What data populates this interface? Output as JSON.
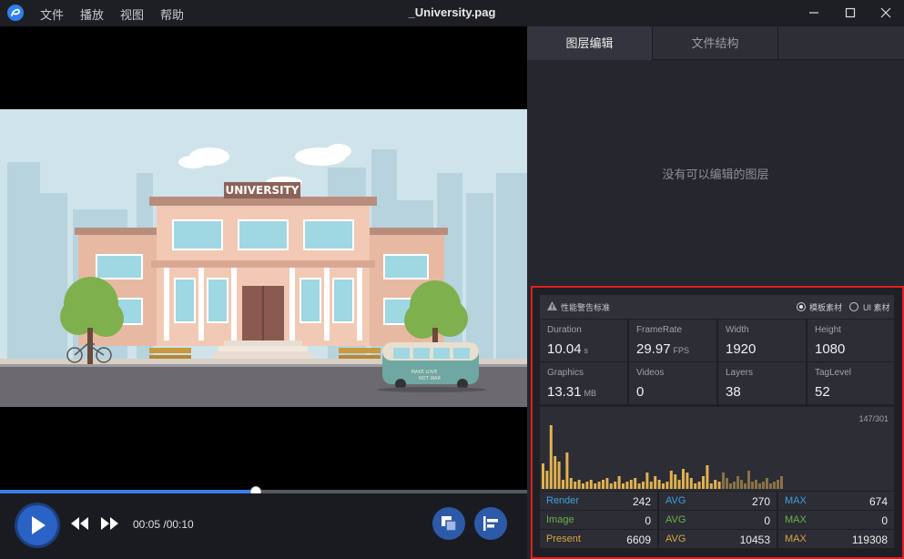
{
  "titlebar": {
    "title": "_University.pag",
    "menu": [
      "文件",
      "播放",
      "视图",
      "帮助"
    ]
  },
  "player": {
    "time_display": "00:05 /00:10",
    "progress_fraction": 0.486,
    "scene_sign": "UNIVERSITY",
    "bus_text_1": "MAKE LOVE",
    "bus_text_2": "NOT WAR"
  },
  "panel": {
    "tabs": [
      {
        "label": "图层编辑",
        "active": true
      },
      {
        "label": "文件结构",
        "active": false
      }
    ],
    "empty_message": "没有可以编辑的图层"
  },
  "performance": {
    "warning_label": "性能警告标准",
    "options": [
      {
        "label": "模板素材",
        "selected": true
      },
      {
        "label": "UI 素材",
        "selected": false
      }
    ],
    "stats": [
      {
        "label": "Duration",
        "value": "10.04",
        "unit": "s"
      },
      {
        "label": "FrameRate",
        "value": "29.97",
        "unit": "FPS"
      },
      {
        "label": "Width",
        "value": "1920",
        "unit": ""
      },
      {
        "label": "Height",
        "value": "1080",
        "unit": ""
      },
      {
        "label": "Graphics",
        "value": "13.31",
        "unit": "MB"
      },
      {
        "label": "Videos",
        "value": "0",
        "unit": ""
      },
      {
        "label": "Layers",
        "value": "38",
        "unit": ""
      },
      {
        "label": "TagLevel",
        "value": "52",
        "unit": ""
      }
    ],
    "frame_counter": "147/301",
    "metrics": [
      {
        "name": "Render",
        "value": "242",
        "avg_label": "AVG",
        "avg": "270",
        "max_label": "MAX",
        "max": "674",
        "color": "#3f9de0"
      },
      {
        "name": "Image",
        "value": "0",
        "avg_label": "AVG",
        "avg": "0",
        "max_label": "MAX",
        "max": "0",
        "color": "#6fb04a"
      },
      {
        "name": "Present",
        "value": "6609",
        "avg_label": "AVG",
        "avg": "10453",
        "max_label": "MAX",
        "max": "119308",
        "color": "#d9a441"
      }
    ]
  },
  "colors": {
    "accent": "#3b7de8",
    "highlight_border": "#e0201f",
    "render": "#3f9de0",
    "image": "#6fb04a",
    "present": "#d9a441"
  }
}
